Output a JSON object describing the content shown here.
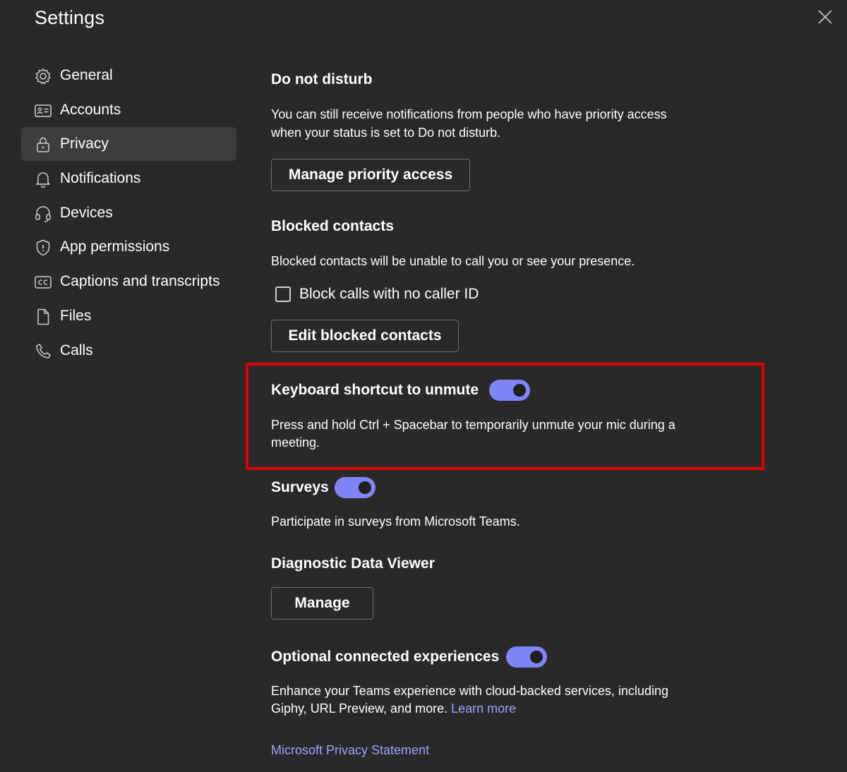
{
  "window": {
    "title": "Settings"
  },
  "sidebar": {
    "items": [
      {
        "label": "General",
        "icon": "gear-icon",
        "active": false
      },
      {
        "label": "Accounts",
        "icon": "id-card-icon",
        "active": false
      },
      {
        "label": "Privacy",
        "icon": "lock-icon",
        "active": true
      },
      {
        "label": "Notifications",
        "icon": "bell-icon",
        "active": false
      },
      {
        "label": "Devices",
        "icon": "headset-icon",
        "active": false
      },
      {
        "label": "App permissions",
        "icon": "shield-icon",
        "active": false
      },
      {
        "label": "Captions and transcripts",
        "icon": "cc-icon",
        "active": false
      },
      {
        "label": "Files",
        "icon": "file-icon",
        "active": false
      },
      {
        "label": "Calls",
        "icon": "phone-icon",
        "active": false
      }
    ]
  },
  "dnd": {
    "heading": "Do not disturb",
    "line1": "You can still receive notifications from people who have priority access",
    "line2": "when your status is set to Do not disturb.",
    "button": "Manage priority access"
  },
  "blocked": {
    "heading": "Blocked contacts",
    "desc": "Blocked contacts will be unable to call you or see your presence.",
    "checkbox_label": "Block calls with no caller ID",
    "checkbox_checked": false,
    "button": "Edit blocked contacts"
  },
  "keyboard": {
    "heading": "Keyboard shortcut to unmute",
    "toggle_on": true,
    "line1": "Press and hold Ctrl + Spacebar to temporarily unmute your mic during a",
    "line2": "meeting."
  },
  "surveys": {
    "heading": "Surveys",
    "toggle_on": true,
    "desc": "Participate in surveys from Microsoft Teams."
  },
  "diagnostic": {
    "heading": "Diagnostic Data Viewer",
    "button": "Manage"
  },
  "optional": {
    "heading": "Optional connected experiences",
    "toggle_on": true,
    "line1": "Enhance your Teams experience with cloud-backed services, including",
    "line2": "Giphy, URL Preview, and more.",
    "link": "Learn more"
  },
  "footer": {
    "privacy_link": "Microsoft Privacy Statement"
  },
  "colors": {
    "accent": "#7f85f5",
    "link": "#9ea2ff",
    "highlight": "#e00000",
    "background": "#292929"
  }
}
